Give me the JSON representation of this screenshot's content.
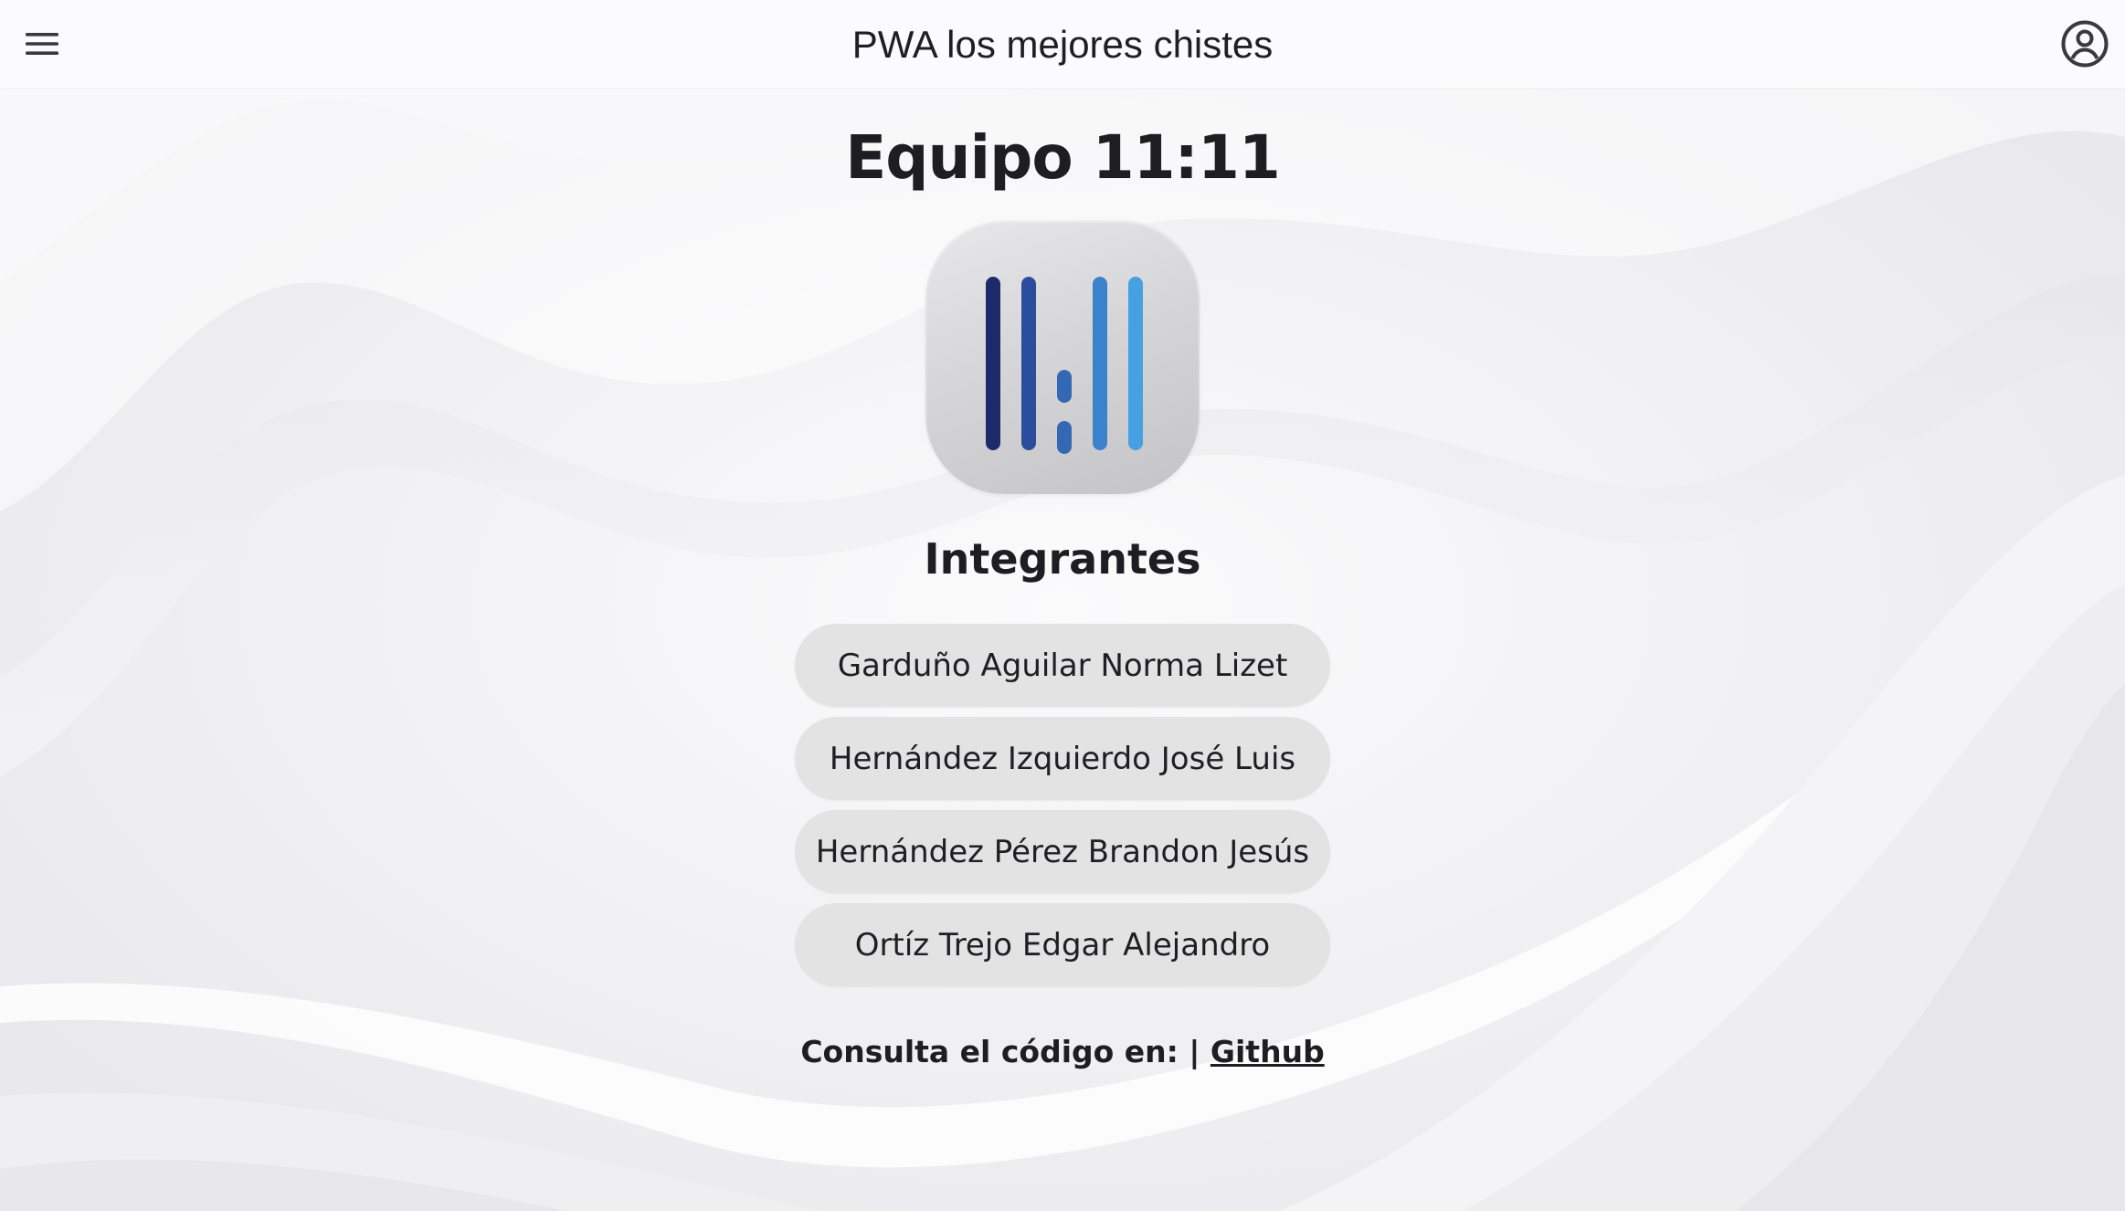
{
  "appbar": {
    "title": "PWA los mejores chistes",
    "menu_icon": "hamburger-menu-icon",
    "account_icon": "account-circle-icon"
  },
  "team": {
    "title": "Equipo 11:11",
    "logo": "team-logo-bars",
    "logo_colors": [
      "#1b2a6e",
      "#2a4ea0",
      "#3a74c0",
      "#3f8ed8",
      "#48a2e4"
    ]
  },
  "members_section": {
    "title": "Integrantes",
    "members": [
      "Garduño Aguilar Norma Lizet",
      "Hernández Izquierdo José Luis",
      "Hernández Pérez Brandon Jesús",
      "Ortíz Trejo Edgar Alejandro"
    ]
  },
  "footer": {
    "prefix": "Consulta el código en: | ",
    "link_label": "Github"
  }
}
